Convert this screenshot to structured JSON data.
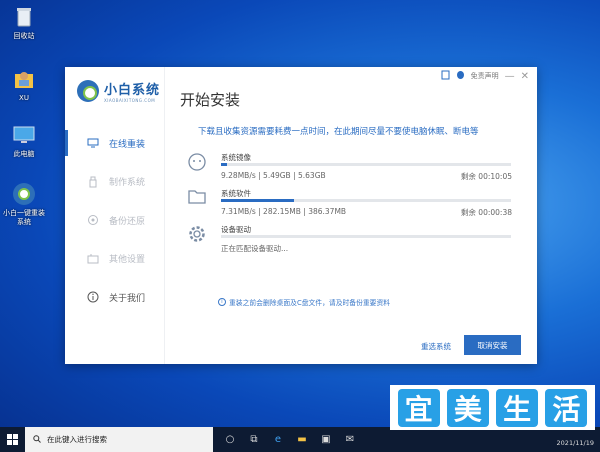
{
  "desktop": {
    "icons": [
      {
        "label": "回收站",
        "icon": "recycle-bin-icon"
      },
      {
        "label": "XU",
        "icon": "user-folder-icon"
      },
      {
        "label": "此电脑",
        "icon": "this-pc-icon"
      },
      {
        "label": "小白一键重装系统",
        "icon": "xiaobai-app-icon"
      }
    ]
  },
  "installer": {
    "logo": {
      "title": "小白系统",
      "subtitle": "XIAOBAIXITONG.COM"
    },
    "page_title": "开始安装",
    "topbar": {
      "disclaimer_label": "免责声明"
    },
    "nav": [
      {
        "label": "在线重装",
        "icon": "monitor-icon",
        "state": "active"
      },
      {
        "label": "制作系统",
        "icon": "usb-drive-icon",
        "state": "disabled"
      },
      {
        "label": "备份还原",
        "icon": "backup-icon",
        "state": "disabled"
      },
      {
        "label": "其他设置",
        "icon": "settings-box-icon",
        "state": "disabled"
      },
      {
        "label": "关于我们",
        "icon": "info-icon",
        "state": "normal"
      }
    ],
    "notice": "下载且收集资源需要耗费一点时间，在此期间尽量不要使电脑休眠、断电等",
    "tasks": [
      {
        "name": "系统镜像",
        "icon": "face-loading-icon",
        "progress": 0.02,
        "stats": "9.28MB/s | 5.49GB | 5.63GB",
        "time": "剩余 00:10:05"
      },
      {
        "name": "系统软件",
        "icon": "folder-icon",
        "progress": 0.25,
        "stats": "7.31MB/s | 282.15MB | 386.37MB",
        "time": "剩余 00:00:38"
      },
      {
        "name": "设备驱动",
        "icon": "gear-icon",
        "progress": 0.0,
        "stats": "正在匹配设备驱动...",
        "time": ""
      }
    ],
    "tip": "重装之前会删除桌面及C盘文件，请及时备份重要资料",
    "buttons": {
      "reselect": "重选系统",
      "cancel": "取消安装"
    }
  },
  "taskbar": {
    "search_placeholder": "在此键入进行搜索",
    "date": "2021/11/19"
  },
  "watermark": {
    "chars": [
      "宜",
      "美",
      "生",
      "活"
    ]
  },
  "colors": {
    "accent": "#2a6cc2",
    "taskbar": "#0d1b33",
    "watermark": "#28a0e6"
  }
}
